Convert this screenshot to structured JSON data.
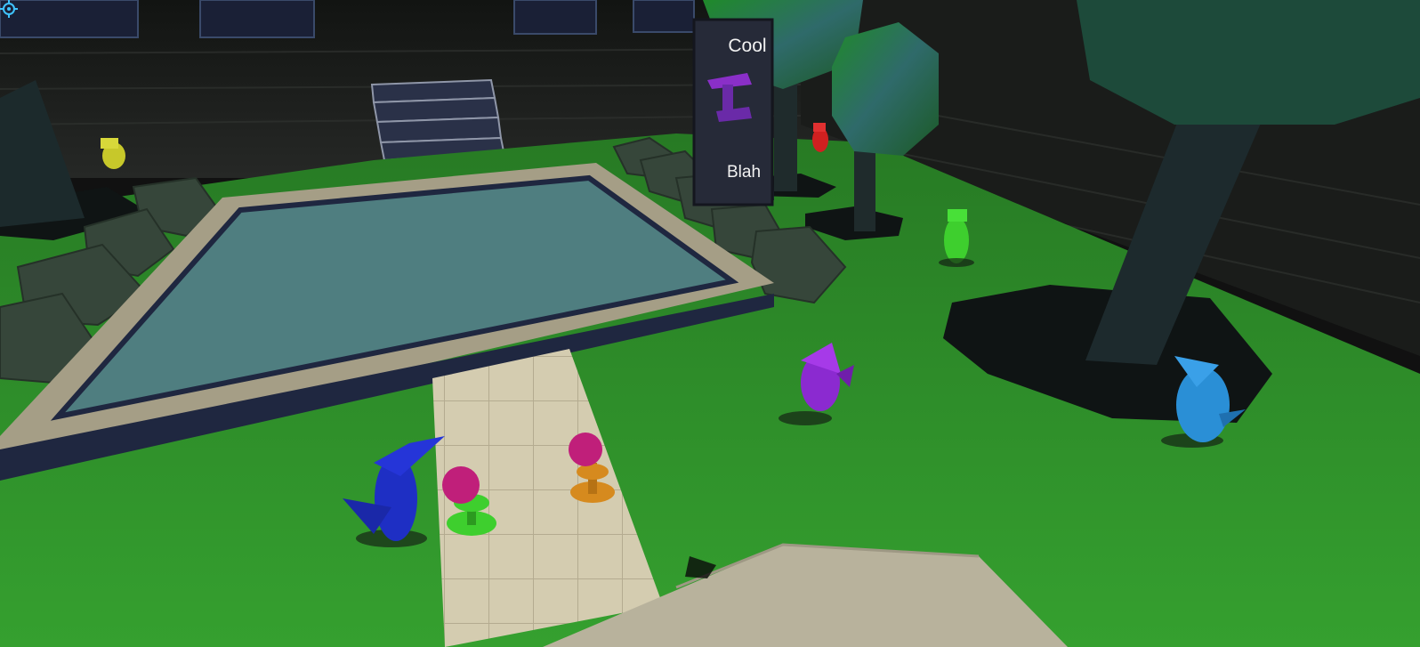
{
  "sign": {
    "top_label": "Cool",
    "bottom_label": "Blah"
  },
  "colors": {
    "grass": "#2e8f2a",
    "water": "#4f7e80",
    "wall": "#1b1d1b",
    "path": "#cfc6a8",
    "bird_blue": "#1e2fc4",
    "bird_purple": "#8b2ad0",
    "bird_cyan": "#2a8fd6",
    "bird_green": "#3ecf2e",
    "bird_yellow": "#c7c82a",
    "bird_red": "#d02020",
    "reticle": "#3fc3ff"
  },
  "icons": {
    "reticle": "crosshair-icon",
    "sign_emblem": "hammer-icon"
  }
}
